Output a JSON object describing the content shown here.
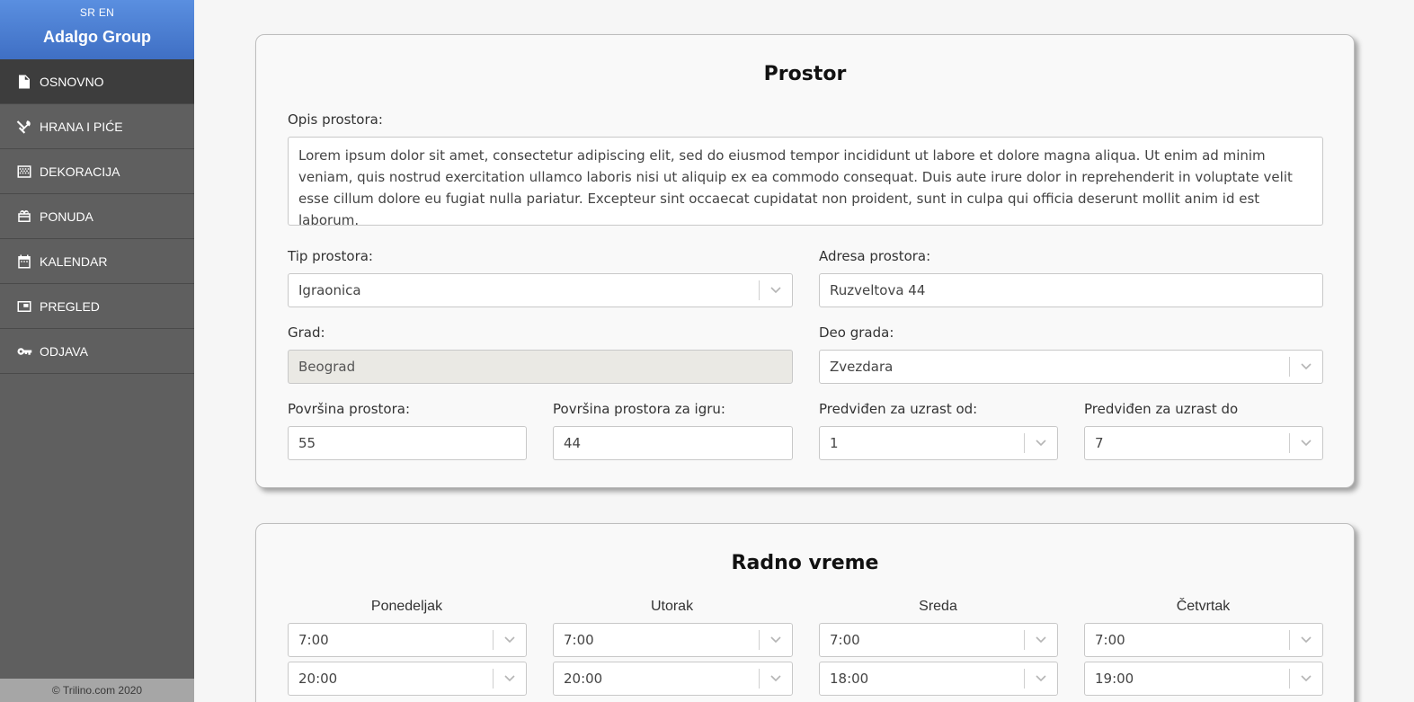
{
  "sidebar": {
    "lang_sr": "SR",
    "lang_en": "EN",
    "brand": "Adalgo Group",
    "items": [
      {
        "label": "OSNOVNO",
        "icon": "document-icon"
      },
      {
        "label": "HRANA I PIĆE",
        "icon": "utensils-icon"
      },
      {
        "label": "DEKORACIJA",
        "icon": "decoration-icon"
      },
      {
        "label": "PONUDA",
        "icon": "gift-icon"
      },
      {
        "label": "KALENDAR",
        "icon": "calendar-icon"
      },
      {
        "label": "PREGLED",
        "icon": "preview-icon"
      },
      {
        "label": "ODJAVA",
        "icon": "key-icon"
      }
    ],
    "footer": "© Trilino.com 2020"
  },
  "prostor": {
    "title": "Prostor",
    "opis_label": "Opis prostora:",
    "opis_value": "Lorem ipsum dolor sit amet, consectetur adipiscing elit, sed do eiusmod tempor incididunt ut labore et dolore magna aliqua. Ut enim ad minim veniam, quis nostrud exercitation ullamco laboris nisi ut aliquip ex ea commodo consequat. Duis aute irure dolor in reprehenderit in voluptate velit esse cillum dolore eu fugiat nulla pariatur. Excepteur sint occaecat cupidatat non proident, sunt in culpa qui officia deserunt mollit anim id est laborum.",
    "tip_label": "Tip prostora:",
    "tip_value": "Igraonica",
    "adresa_label": "Adresa prostora:",
    "adresa_value": "Ruzveltova 44",
    "grad_label": "Grad:",
    "grad_value": "Beograd",
    "deo_label": "Deo grada:",
    "deo_value": "Zvezdara",
    "povrsina_label": "Površina prostora:",
    "povrsina_value": "55",
    "povrsina_igra_label": "Površina prostora za igru:",
    "povrsina_igra_value": "44",
    "uzrast_od_label": "Predviđen za uzrast od:",
    "uzrast_od_value": "1",
    "uzrast_do_label": "Predviđen za uzrast do",
    "uzrast_do_value": "7"
  },
  "radno_vreme": {
    "title": "Radno vreme",
    "days": [
      {
        "name": "Ponedeljak",
        "open": "7:00",
        "close": "20:00"
      },
      {
        "name": "Utorak",
        "open": "7:00",
        "close": "20:00"
      },
      {
        "name": "Sreda",
        "open": "7:00",
        "close": "18:00"
      },
      {
        "name": "Četvrtak",
        "open": "7:00",
        "close": "19:00"
      }
    ]
  },
  "colors": {
    "sidebar_bg": "#5f5f5f",
    "sidebar_active": "#3d3d3d",
    "brand_blue": "#4a7fd6"
  }
}
